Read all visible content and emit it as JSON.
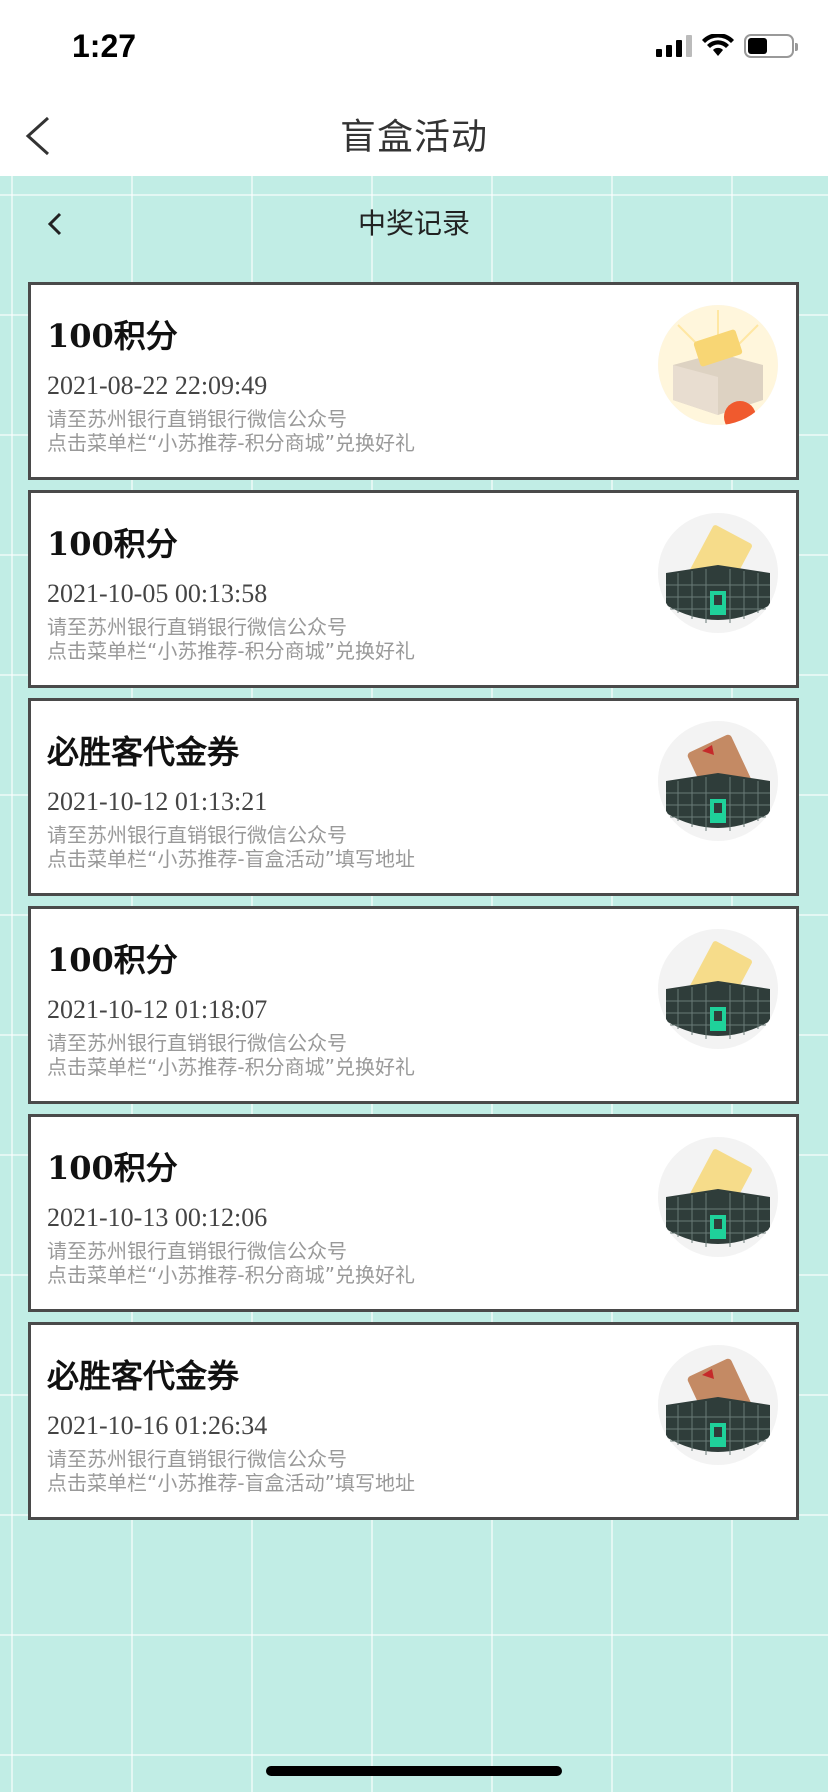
{
  "status_bar": {
    "time": "1:27"
  },
  "header": {
    "title": "盲盒活动"
  },
  "sub_header": {
    "title": "中奖记录"
  },
  "records": [
    {
      "title": "100积分",
      "time": "2021-08-22 22:09:49",
      "line1": "请至苏州银行直销银行微信公众号",
      "line2": "点击菜单栏“小苏推荐-积分商城”兑换好礼",
      "icon": "points-gift-box-orange-icon"
    },
    {
      "title": "100积分",
      "time": "2021-10-05 00:13:58",
      "line1": "请至苏州银行直销银行微信公众号",
      "line2": "点击菜单栏“小苏推荐-积分商城”兑换好礼",
      "icon": "points-card-box-icon"
    },
    {
      "title": "必胜客代金券",
      "time": "2021-10-12 01:13:21",
      "line1": "请至苏州银行直销银行微信公众号",
      "line2": "点击菜单栏“小苏推荐-盲盒活动”填写地址",
      "icon": "pizza-voucher-box-icon"
    },
    {
      "title": "100积分",
      "time": "2021-10-12 01:18:07",
      "line1": "请至苏州银行直销银行微信公众号",
      "line2": "点击菜单栏“小苏推荐-积分商城”兑换好礼",
      "icon": "points-card-box-icon"
    },
    {
      "title": "100积分",
      "time": "2021-10-13 00:12:06",
      "line1": "请至苏州银行直销银行微信公众号",
      "line2": "点击菜单栏“小苏推荐-积分商城”兑换好礼",
      "icon": "points-card-box-icon"
    },
    {
      "title": "必胜客代金券",
      "time": "2021-10-16 01:26:34",
      "line1": "请至苏州银行直销银行微信公众号",
      "line2": "点击菜单栏“小苏推荐-盲盒活动”填写地址",
      "icon": "pizza-voucher-box-icon"
    }
  ],
  "colors": {
    "background": "#c1ede5",
    "card_border": "#4a4a4a",
    "box_dark": "#2f3d3a",
    "box_accent": "#1fd19a"
  }
}
